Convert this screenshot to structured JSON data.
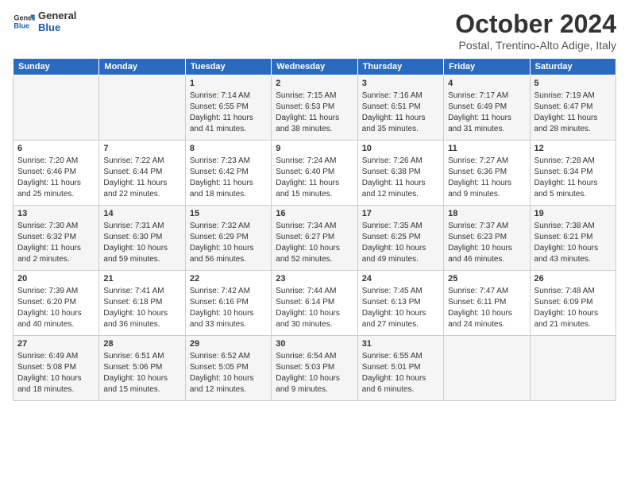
{
  "header": {
    "logo_line1": "General",
    "logo_line2": "Blue",
    "month": "October 2024",
    "location": "Postal, Trentino-Alto Adige, Italy"
  },
  "days_of_week": [
    "Sunday",
    "Monday",
    "Tuesday",
    "Wednesday",
    "Thursday",
    "Friday",
    "Saturday"
  ],
  "weeks": [
    [
      {
        "day": "",
        "info": ""
      },
      {
        "day": "",
        "info": ""
      },
      {
        "day": "1",
        "info": "Sunrise: 7:14 AM\nSunset: 6:55 PM\nDaylight: 11 hours and 41 minutes."
      },
      {
        "day": "2",
        "info": "Sunrise: 7:15 AM\nSunset: 6:53 PM\nDaylight: 11 hours and 38 minutes."
      },
      {
        "day": "3",
        "info": "Sunrise: 7:16 AM\nSunset: 6:51 PM\nDaylight: 11 hours and 35 minutes."
      },
      {
        "day": "4",
        "info": "Sunrise: 7:17 AM\nSunset: 6:49 PM\nDaylight: 11 hours and 31 minutes."
      },
      {
        "day": "5",
        "info": "Sunrise: 7:19 AM\nSunset: 6:47 PM\nDaylight: 11 hours and 28 minutes."
      }
    ],
    [
      {
        "day": "6",
        "info": "Sunrise: 7:20 AM\nSunset: 6:46 PM\nDaylight: 11 hours and 25 minutes."
      },
      {
        "day": "7",
        "info": "Sunrise: 7:22 AM\nSunset: 6:44 PM\nDaylight: 11 hours and 22 minutes."
      },
      {
        "day": "8",
        "info": "Sunrise: 7:23 AM\nSunset: 6:42 PM\nDaylight: 11 hours and 18 minutes."
      },
      {
        "day": "9",
        "info": "Sunrise: 7:24 AM\nSunset: 6:40 PM\nDaylight: 11 hours and 15 minutes."
      },
      {
        "day": "10",
        "info": "Sunrise: 7:26 AM\nSunset: 6:38 PM\nDaylight: 11 hours and 12 minutes."
      },
      {
        "day": "11",
        "info": "Sunrise: 7:27 AM\nSunset: 6:36 PM\nDaylight: 11 hours and 9 minutes."
      },
      {
        "day": "12",
        "info": "Sunrise: 7:28 AM\nSunset: 6:34 PM\nDaylight: 11 hours and 5 minutes."
      }
    ],
    [
      {
        "day": "13",
        "info": "Sunrise: 7:30 AM\nSunset: 6:32 PM\nDaylight: 11 hours and 2 minutes."
      },
      {
        "day": "14",
        "info": "Sunrise: 7:31 AM\nSunset: 6:30 PM\nDaylight: 10 hours and 59 minutes."
      },
      {
        "day": "15",
        "info": "Sunrise: 7:32 AM\nSunset: 6:29 PM\nDaylight: 10 hours and 56 minutes."
      },
      {
        "day": "16",
        "info": "Sunrise: 7:34 AM\nSunset: 6:27 PM\nDaylight: 10 hours and 52 minutes."
      },
      {
        "day": "17",
        "info": "Sunrise: 7:35 AM\nSunset: 6:25 PM\nDaylight: 10 hours and 49 minutes."
      },
      {
        "day": "18",
        "info": "Sunrise: 7:37 AM\nSunset: 6:23 PM\nDaylight: 10 hours and 46 minutes."
      },
      {
        "day": "19",
        "info": "Sunrise: 7:38 AM\nSunset: 6:21 PM\nDaylight: 10 hours and 43 minutes."
      }
    ],
    [
      {
        "day": "20",
        "info": "Sunrise: 7:39 AM\nSunset: 6:20 PM\nDaylight: 10 hours and 40 minutes."
      },
      {
        "day": "21",
        "info": "Sunrise: 7:41 AM\nSunset: 6:18 PM\nDaylight: 10 hours and 36 minutes."
      },
      {
        "day": "22",
        "info": "Sunrise: 7:42 AM\nSunset: 6:16 PM\nDaylight: 10 hours and 33 minutes."
      },
      {
        "day": "23",
        "info": "Sunrise: 7:44 AM\nSunset: 6:14 PM\nDaylight: 10 hours and 30 minutes."
      },
      {
        "day": "24",
        "info": "Sunrise: 7:45 AM\nSunset: 6:13 PM\nDaylight: 10 hours and 27 minutes."
      },
      {
        "day": "25",
        "info": "Sunrise: 7:47 AM\nSunset: 6:11 PM\nDaylight: 10 hours and 24 minutes."
      },
      {
        "day": "26",
        "info": "Sunrise: 7:48 AM\nSunset: 6:09 PM\nDaylight: 10 hours and 21 minutes."
      }
    ],
    [
      {
        "day": "27",
        "info": "Sunrise: 6:49 AM\nSunset: 5:08 PM\nDaylight: 10 hours and 18 minutes."
      },
      {
        "day": "28",
        "info": "Sunrise: 6:51 AM\nSunset: 5:06 PM\nDaylight: 10 hours and 15 minutes."
      },
      {
        "day": "29",
        "info": "Sunrise: 6:52 AM\nSunset: 5:05 PM\nDaylight: 10 hours and 12 minutes."
      },
      {
        "day": "30",
        "info": "Sunrise: 6:54 AM\nSunset: 5:03 PM\nDaylight: 10 hours and 9 minutes."
      },
      {
        "day": "31",
        "info": "Sunrise: 6:55 AM\nSunset: 5:01 PM\nDaylight: 10 hours and 6 minutes."
      },
      {
        "day": "",
        "info": ""
      },
      {
        "day": "",
        "info": ""
      }
    ]
  ]
}
